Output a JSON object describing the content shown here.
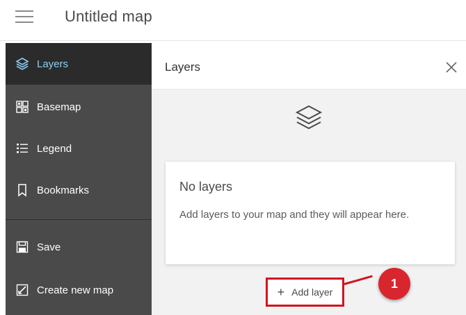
{
  "app": {
    "title": "Untitled map"
  },
  "sidebar": {
    "items": [
      {
        "label": "Layers",
        "icon": "layers-icon",
        "active": true
      },
      {
        "label": "Basemap",
        "icon": "basemap-grid-icon"
      },
      {
        "label": "Legend",
        "icon": "legend-list-icon"
      },
      {
        "label": "Bookmarks",
        "icon": "bookmark-icon"
      },
      {
        "label": "Save",
        "icon": "save-icon"
      },
      {
        "label": "Create new map",
        "icon": "new-map-icon"
      }
    ]
  },
  "panel": {
    "title": "Layers",
    "empty": {
      "title": "No layers",
      "text": "Add layers to your map and they will appear here."
    },
    "add_button_label": "Add layer",
    "add_button_icon": "+",
    "callout_number": "1"
  },
  "colors": {
    "sidebar_bg": "#4a4a4a",
    "sidebar_active_bg": "#2b2b2b",
    "active_accent": "#8ccff5",
    "callout_red": "#d9252d"
  }
}
